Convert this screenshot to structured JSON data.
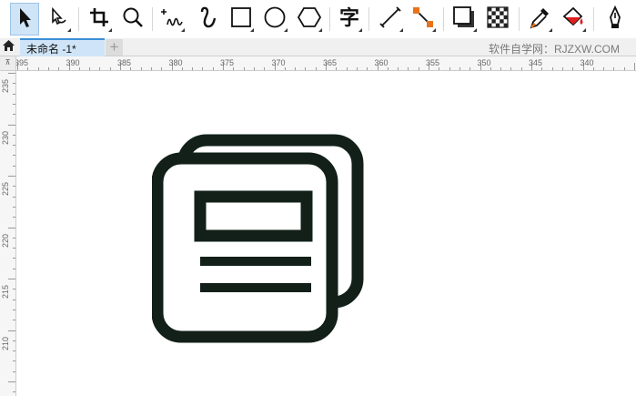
{
  "toolbar": {
    "tools": [
      {
        "name": "pick-tool-icon"
      },
      {
        "name": "shape-tool-icon"
      },
      {
        "name": "crop-tool-icon"
      },
      {
        "name": "zoom-tool-icon"
      },
      {
        "name": "freehand-tool-icon"
      },
      {
        "name": "artistic-media-icon"
      },
      {
        "name": "rectangle-tool-icon"
      },
      {
        "name": "ellipse-tool-icon"
      },
      {
        "name": "polygon-tool-icon"
      },
      {
        "name": "text-tool-icon"
      },
      {
        "name": "parallel-dimension-icon"
      },
      {
        "name": "connector-tool-icon"
      },
      {
        "name": "drop-shadow-icon"
      },
      {
        "name": "transparency-icon"
      },
      {
        "name": "eyedropper-icon"
      },
      {
        "name": "interactive-fill-icon"
      },
      {
        "name": "smart-fill-icon"
      }
    ],
    "text_tool_glyph": "字"
  },
  "tabs": {
    "document_title": "未命名 -1*",
    "add_label": "+",
    "watermark": "软件自学网：RJZXW.COM"
  },
  "rulers": {
    "corner_label": "⊼",
    "horizontal": [
      "395",
      "390",
      "385",
      "380",
      "375",
      "370",
      "365",
      "360",
      "355",
      "350",
      "345",
      "340"
    ],
    "vertical": [
      "235",
      "230",
      "225",
      "220",
      "215",
      "210"
    ]
  },
  "colors": {
    "artwork_stroke": "#122019",
    "selection": "#cfe4f7",
    "accent": "#3c8fd5",
    "fill_red": "#e02020",
    "connector_orange": "#e8731a"
  }
}
